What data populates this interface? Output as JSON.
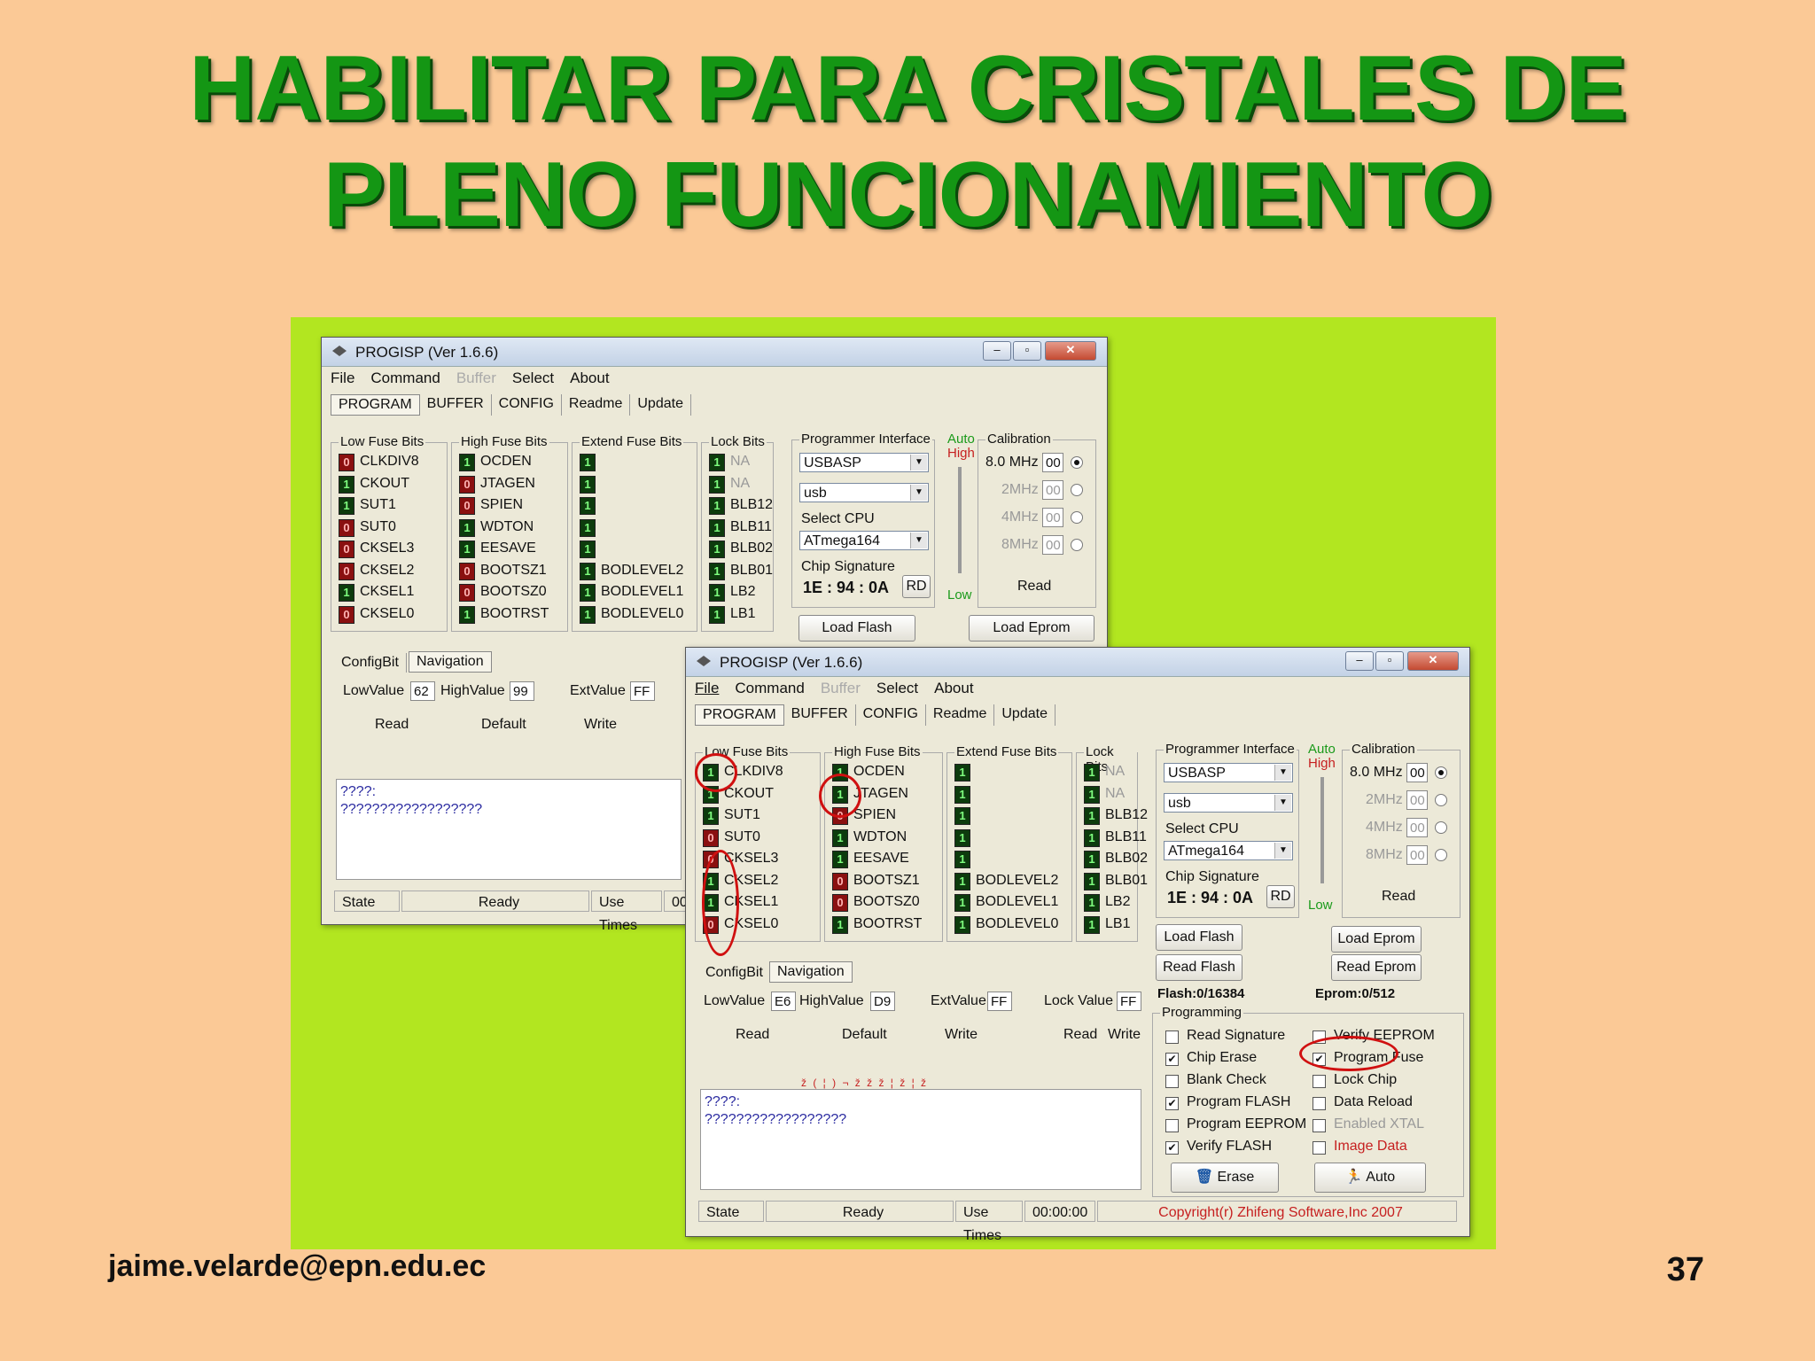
{
  "slide": {
    "title_line1": "HABILITAR PARA CRISTALES DE",
    "title_line2": "PLENO FUNCIONAMIENTO",
    "email": "jaime.velarde@epn.edu.ec",
    "page_number": "37"
  },
  "window": {
    "title": "PROGISP (Ver 1.6.6)",
    "menu": [
      "File",
      "Command",
      "Buffer",
      "Select",
      "About"
    ],
    "tabs": [
      "PROGRAM",
      "BUFFER",
      "CONFIG",
      "Readme",
      "Update"
    ],
    "groups": {
      "low": "Low Fuse Bits",
      "high": "High Fuse Bits",
      "extend": "Extend Fuse Bits",
      "lock": "Lock Bits",
      "prog_if": "Programmer Interface",
      "calibration": "Calibration",
      "select_cpu": "Select CPU",
      "chip_sig": "Chip Signature",
      "programming": "Programming"
    },
    "low_labels": [
      "CLKDIV8",
      "CKOUT",
      "SUT1",
      "SUT0",
      "CKSEL3",
      "CKSEL2",
      "CKSEL1",
      "CKSEL0"
    ],
    "high_labels": [
      "OCDEN",
      "JTAGEN",
      "SPIEN",
      "WDTON",
      "EESAVE",
      "BOOTSZ1",
      "BOOTSZ0",
      "BOOTRST"
    ],
    "extend_labels": [
      "",
      "",
      "",
      "",
      "",
      "BODLEVEL2",
      "BODLEVEL1",
      "BODLEVEL0"
    ],
    "lock_labels": [
      "NA",
      "NA",
      "BLB12",
      "BLB11",
      "BLB02",
      "BLB01",
      "LB2",
      "LB1"
    ],
    "auto": "Auto",
    "high": "High",
    "low": "Low",
    "cal_freqs": [
      "8.0 MHz",
      "2MHz",
      "4MHz",
      "8MHz"
    ],
    "cal_values": [
      "00",
      "00",
      "00",
      "00"
    ],
    "cal_read": "Read",
    "interface": "USBASP",
    "port": "usb",
    "cpu": "ATmega164",
    "signature": "1E : 94 : 0A",
    "rd": "RD",
    "config_tabs": [
      "ConfigBit",
      "Navigation"
    ],
    "low_value_label": "LowValue",
    "high_value_label": "HighValue",
    "ext_value_label": "ExtValue",
    "lock_value_label": "Lock Value",
    "read": "Read",
    "default": "Default",
    "write": "Write",
    "log_line1": "????:",
    "log_line2": "??????????????????",
    "state": "State",
    "ready": "Ready",
    "use_times": "Use Times",
    "time": "00:00:00",
    "copyright": "Copyright(r) Zhifeng Software,Inc 2007"
  },
  "window1": {
    "low_bits": [
      "0",
      "1",
      "1",
      "0",
      "0",
      "0",
      "1",
      "0"
    ],
    "high_bits": [
      "1",
      "0",
      "0",
      "1",
      "1",
      "0",
      "0",
      "1"
    ],
    "extend_bits": [
      "1",
      "1",
      "1",
      "1",
      "1",
      "1",
      "1",
      "1"
    ],
    "lock_bits": [
      "1",
      "1",
      "1",
      "1",
      "1",
      "1",
      "1",
      "1"
    ],
    "low_value": "62",
    "high_value": "99",
    "ext_value": "FF",
    "load_flash": "Load Flash",
    "load_eprom": "Load Eprom",
    "time_partial": "00:("
  },
  "window2": {
    "low_bits": [
      "1",
      "1",
      "1",
      "0",
      "0",
      "1",
      "1",
      "0"
    ],
    "high_bits": [
      "1",
      "1",
      "0",
      "1",
      "1",
      "0",
      "0",
      "1"
    ],
    "extend_bits": [
      "1",
      "1",
      "1",
      "1",
      "1",
      "1",
      "1",
      "1"
    ],
    "lock_bits": [
      "1",
      "1",
      "1",
      "1",
      "1",
      "1",
      "1",
      "1"
    ],
    "low_value": "E6",
    "high_value": "D9",
    "ext_value": "FF",
    "lock_value": "FF",
    "buttons": [
      "Load Flash",
      "Read Flash",
      "Load Eprom",
      "Read Eprom"
    ],
    "flash": "Flash:0/16384",
    "eprom": "Eprom:0/512",
    "programming_left": [
      {
        "label": "Read Signature",
        "checked": false
      },
      {
        "label": "Chip Erase",
        "checked": true
      },
      {
        "label": "Blank Check",
        "checked": false
      },
      {
        "label": "Program FLASH",
        "checked": true
      },
      {
        "label": "Program EEPROM",
        "checked": false
      },
      {
        "label": "Verify FLASH",
        "checked": true
      }
    ],
    "programming_right": [
      {
        "label": "Verify EEPROM",
        "checked": false
      },
      {
        "label": "Program Fuse",
        "checked": true
      },
      {
        "label": "Lock Chip",
        "checked": false
      },
      {
        "label": "Data Reload",
        "checked": false
      },
      {
        "label": "Enabled XTAL",
        "checked": false
      },
      {
        "label": "Image Data",
        "checked": false
      }
    ],
    "erase": "Erase",
    "auto_btn": "Auto",
    "garbled": "ž ( ¦ ) ¬ ž  ž    ž    ¦    ž ¦ ž"
  },
  "colors": {
    "background": "#fbc996",
    "panel": "#b2e620",
    "title": "#149614",
    "highlight": "#d01010",
    "bit_on": "#0d3b0d",
    "bit_off": "#8a1010"
  }
}
